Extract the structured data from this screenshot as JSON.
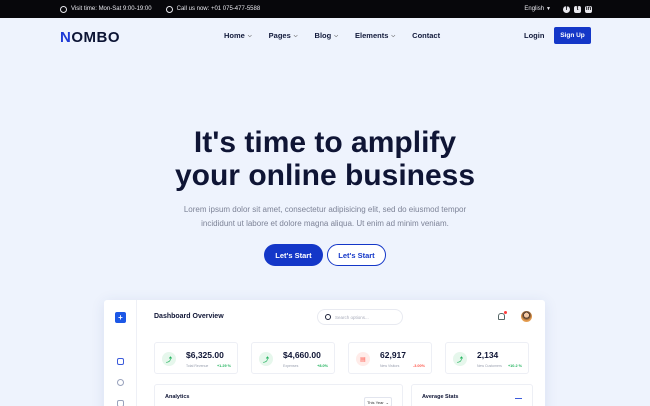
{
  "topbar": {
    "visit": "Visit time: Mon-Sat 9:00-19:00",
    "call": "Call us now: +01 075-477-5588",
    "language": "English",
    "socials": [
      {
        "icon": "facebook-icon",
        "glyph": "f"
      },
      {
        "icon": "twitter-icon",
        "glyph": "t"
      },
      {
        "icon": "linkedin-icon",
        "glyph": "in"
      }
    ]
  },
  "nav": {
    "logo_mark": "N",
    "logo_text": "OMBO",
    "items": [
      {
        "label": "Home",
        "dropdown": true
      },
      {
        "label": "Pages",
        "dropdown": true
      },
      {
        "label": "Blog",
        "dropdown": true
      },
      {
        "label": "Elements",
        "dropdown": true
      },
      {
        "label": "Contact",
        "dropdown": false
      }
    ],
    "login": "Login",
    "signup": "Sign Up"
  },
  "hero": {
    "title_line1": "It's time to amplify",
    "title_line2": "your online business",
    "subtitle_line1": "Lorem ipsum dolor sit amet, consectetur adipisicing elit, sed do eiusmod tempor",
    "subtitle_line2": "incididunt ut labore et dolore magna aliqua. Ut enim ad minim veniam.",
    "primary_button": "Let's Start",
    "secondary_button": "Let's Start"
  },
  "dashboard": {
    "title": "Dashboard Overview",
    "search_placeholder": "Search options...",
    "stats": [
      {
        "value": "$6,325.00",
        "label": "Total Revenue",
        "change": "+1.29 %",
        "color": "#22b35e",
        "bg": "#e6f7ec"
      },
      {
        "value": "$4,660.00",
        "label": "Expenses",
        "change": "+8.0%",
        "color": "#22b35e",
        "bg": "#e6f7ec"
      },
      {
        "value": "62,917",
        "label": "New Visitors",
        "change": "-3.00%",
        "color": "#ff5a4e",
        "bg": "#ffece9"
      },
      {
        "value": "2,134",
        "label": "New Customers",
        "change": "+10.2 %",
        "color": "#22b35e",
        "bg": "#e6f7ec"
      }
    ],
    "analytics_title": "Analytics",
    "analytics_filter": "This Year",
    "average_title": "Average Stats"
  },
  "colors": {
    "accent": "#1437c8",
    "dark": "#0f1535",
    "background": "#eef3fd"
  }
}
